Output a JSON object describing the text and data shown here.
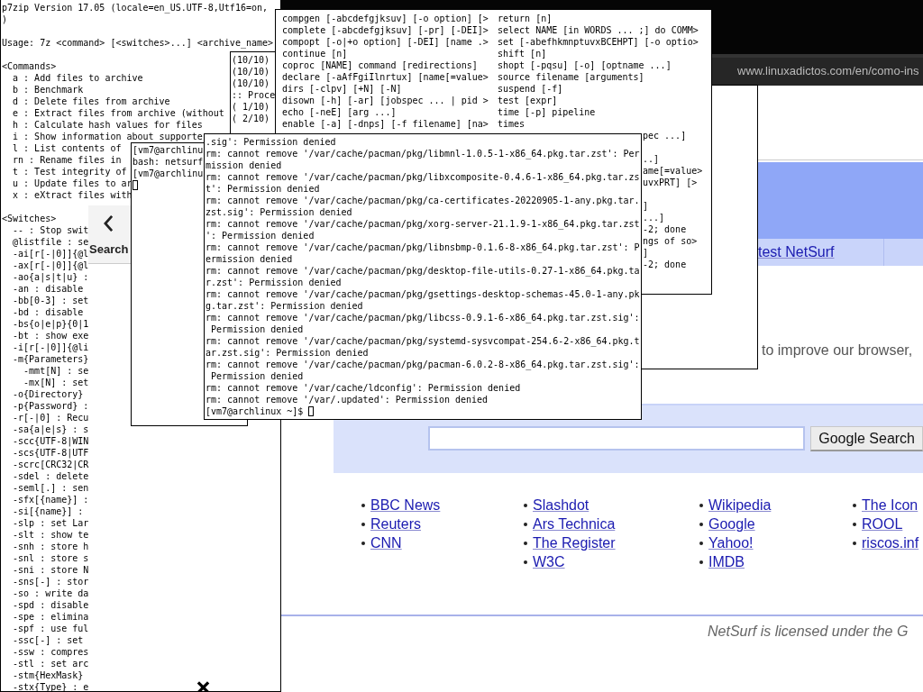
{
  "zip_terminal": {
    "blocks": [
      [
        "p7zip Version 17.05 (locale=en_US.UTF-8,Utf16=on,",
        ")"
      ],
      [
        "Usage: 7z <command> [<switches>...] <archive_name>"
      ],
      [
        "<Commands>",
        "  a : Add files to archive",
        "  b : Benchmark",
        "  d : Delete files from archive",
        "  e : Extract files from archive (without",
        "  h : Calculate hash values for files",
        "  i : Show information about supporte",
        "  l : List contents of",
        "  rn : Rename files in",
        "  t : Test integrity of",
        "  u : Update files to ar",
        "  x : eXtract files with"
      ],
      [
        "<Switches>",
        "  -- : Stop swit",
        "  @listfile : se",
        "  -ai[r[-|0]]{@l",
        "  -ax[r[-|0]]{@l",
        "  -ao{a|s|t|u} :",
        "  -an : disable",
        "  -bb[0-3] : set",
        "  -bd : disable",
        "  -bs{o|e|p}{0|1",
        "  -bt : show exe",
        "  -i[r[-|0]]{@li",
        "  -m{Parameters}",
        "    -mmt[N] : se",
        "    -mx[N] : set",
        "  -o{Directory}",
        "  -p{Password} :",
        "  -r[-|0] : Recu",
        "  -sa{a|e|s} : s",
        "  -scc{UTF-8|WIN",
        "  -scs{UTF-8|UTF",
        "  -scrc[CRC32|CR",
        "  -sdel : delete",
        "  -seml[.] : sen",
        "  -sfx[{name}] :",
        "  -si[{name}] :",
        "  -slp : set Lar",
        "  -slt : show te",
        "  -snh : store h",
        "  -snl : store s",
        "  -sni : store N",
        "  -sns[-] : stor",
        "  -so : write da",
        "  -spd : disable",
        "  -spe : elimina",
        "  -spf : use ful",
        "  -ssc[-] : set",
        "  -ssw : compres",
        "  -stl : set arc",
        "  -stm{HexMask}",
        "  -stx{Type} : e"
      ]
    ]
  },
  "progress_terminal": {
    "lines": [
      "(10/10)",
      "(10/10)",
      "(10/10)",
      ":: Proce",
      "( 1/10)",
      "( 2/10)"
    ]
  },
  "help_terminal": {
    "left_lines": [
      "compgen [-abcdefgjksuv] [-o option] [>",
      "complete [-abcdefgjksuv] [-pr] [-DEI]>",
      "compopt [-o|+o option] [-DEI] [name .>",
      "continue [n]",
      "coproc [NAME] command [redirections]",
      "declare [-aAfFgiIlnrtux] [name[=value>",
      "dirs [-clpv] [+N] [-N]",
      "disown [-h] [-ar] [jobspec ... | pid >",
      "echo [-neE] [arg ...]",
      "enable [-a] [-dnps] [-f filename] [na>"
    ],
    "right_lines": [
      "return [n]",
      "select NAME [in WORDS ... ;] do COMM>",
      "set [-abefhkmnptuvxBCEHPT] [-o optio>",
      "shift [n]",
      "shopt [-pqsu] [-o] [optname ...]",
      "source filename [arguments]",
      "suspend [-f]",
      "test [expr]",
      "time [-p] pipeline",
      "times"
    ],
    "right_fragments": [
      [
        "pec ...]"
      ],
      [
        "..]",
        "ame[=value>",
        "uvxPRT] [>"
      ],
      [
        "]",
        "...]",
        "-2; done",
        "ngs of so>",
        "]",
        "-2; done"
      ]
    ]
  },
  "search_panel": {
    "label": "Search"
  },
  "shell_terminal": {
    "lines": [
      "[vm7@archlinu",
      "bash: netsurf",
      "[vm7@archlinu"
    ]
  },
  "rm_terminal": {
    "lines": [
      ".sig': Permission denied",
      "rm: cannot remove '/var/cache/pacman/pkg/libmnl-1.0.5-1-x86_64.pkg.tar.zst': Per",
      "mission denied",
      "rm: cannot remove '/var/cache/pacman/pkg/libxcomposite-0.4.6-1-x86_64.pkg.tar.zs",
      "t': Permission denied",
      "rm: cannot remove '/var/cache/pacman/pkg/ca-certificates-20220905-1-any.pkg.tar.",
      "zst.sig': Permission denied",
      "rm: cannot remove '/var/cache/pacman/pkg/xorg-server-21.1.9-1-x86_64.pkg.tar.zst",
      "': Permission denied",
      "rm: cannot remove '/var/cache/pacman/pkg/libnsbmp-0.1.6-8-x86_64.pkg.tar.zst': P",
      "ermission denied",
      "rm: cannot remove '/var/cache/pacman/pkg/desktop-file-utils-0.27-1-x86_64.pkg.ta",
      "r.zst': Permission denied",
      "rm: cannot remove '/var/cache/pacman/pkg/gsettings-desktop-schemas-45.0-1-any.pk",
      "g.tar.zst': Permission denied",
      "rm: cannot remove '/var/cache/pacman/pkg/libcss-0.9.1-6-x86_64.pkg.tar.zst.sig':",
      " Permission denied",
      "rm: cannot remove '/var/cache/pacman/pkg/systemd-sysvcompat-254.6-2-x86_64.pkg.t",
      "ar.zst.sig': Permission denied",
      "rm: cannot remove '/var/cache/pacman/pkg/pacman-6.0.2-8-x86_64.pkg.tar.zst.sig':",
      " Permission denied",
      "rm: cannot remove '/var/cache/ldconfig': Permission denied",
      "rm: cannot remove '/var/.updated': Permission denied"
    ],
    "prompt": "[vm7@archlinux ~]$"
  },
  "browser": {
    "url": "www.linuxadictos.com/en/como-ins",
    "tab_link": "test NetSurf",
    "intro": "to improve our browser,",
    "search_button": "Google Search",
    "link_columns": [
      [
        "BBC News",
        "Reuters",
        "CNN"
      ],
      [
        "Slashdot",
        "Ars Technica",
        "The Register",
        "W3C"
      ],
      [
        "Wikipedia",
        "Google",
        "Yahoo!",
        "IMDB"
      ],
      [
        "The Icon",
        "ROOL",
        "riscos.inf"
      ]
    ],
    "footer": "NetSurf is licensed under the G"
  }
}
